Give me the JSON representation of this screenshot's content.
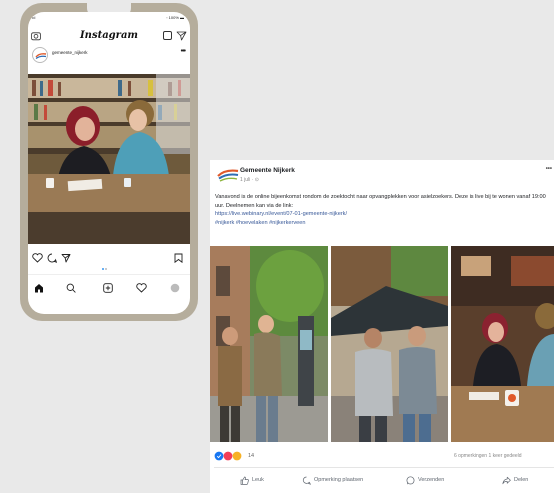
{
  "instagram": {
    "status_signal": "•ıl",
    "status_battery": "◦ 100% ▬",
    "logo": "Instagram",
    "username": "gemeente_nijkerk",
    "more": "•••"
  },
  "facebook": {
    "page_name": "Gemeente Nijkerk",
    "date": "1 juli · ⊙",
    "post_text": "Vanavond is de online bijeenkomst rondom de zoektocht naar opvangplekken voor asielzoekers. Deze is live bij te wonen vanaf 19:00 uur. Deelnemen kan via de link:",
    "post_link": "https://live.webinary.nl/event/07-01-gemeente-nijkerk/",
    "post_tags": "#nijkerk #hoevelaken #nijkerkerveen",
    "reaction_count": "14",
    "stats": "6 opmerkingen  1 keer gedeeld",
    "like_label": "Leuk",
    "comment_label": "Opmerking plaatsen",
    "send_label": "Verzenden",
    "share_label": "Delen",
    "more": "•••"
  },
  "colors": {
    "phone_frame": "#b5ad9c",
    "background": "#e9e9e9",
    "fb_link": "#385898",
    "ig_active_dot": "#3897f0"
  }
}
